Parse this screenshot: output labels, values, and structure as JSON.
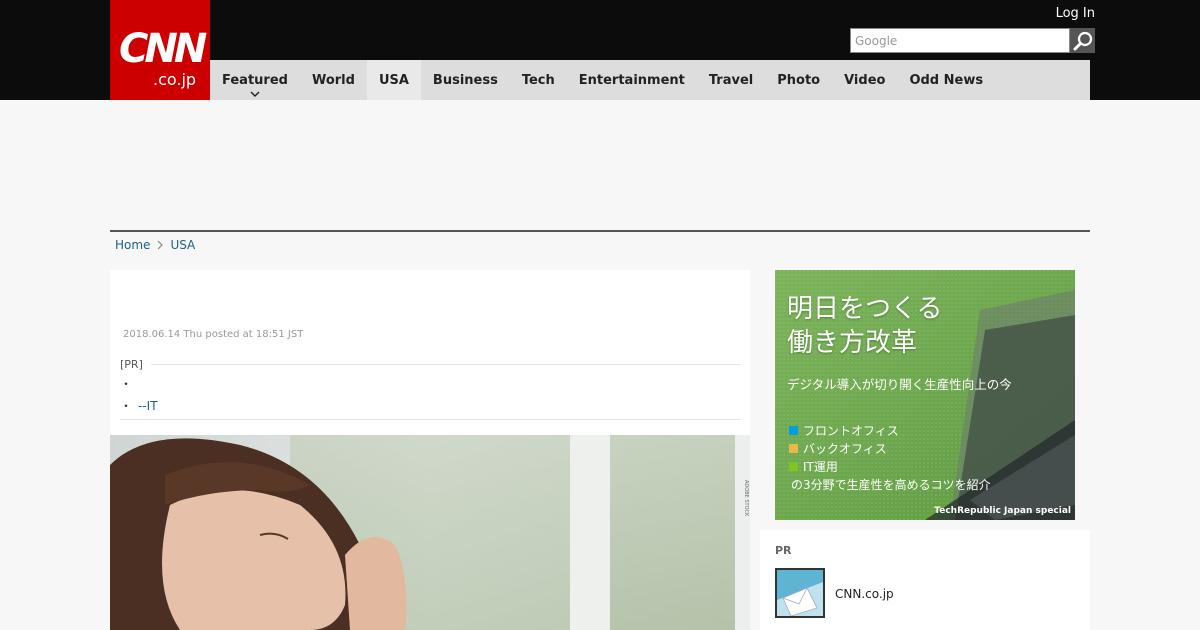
{
  "header": {
    "logo": {
      "main": "CNN",
      "sub": ".co.jp"
    },
    "login_label": "Log In",
    "search": {
      "placeholder": "Google",
      "value": "",
      "icon": "search-icon"
    }
  },
  "nav": {
    "items": [
      {
        "label": "Featured",
        "has_dropdown": true
      },
      {
        "label": "World"
      },
      {
        "label": "USA",
        "active": true
      },
      {
        "label": "Business"
      },
      {
        "label": "Tech"
      },
      {
        "label": "Entertainment"
      },
      {
        "label": "Travel"
      },
      {
        "label": "Photo"
      },
      {
        "label": "Video"
      },
      {
        "label": "Odd News"
      }
    ]
  },
  "breadcrumb": {
    "home": "Home",
    "current": "USA"
  },
  "article": {
    "dateline": "2018.06.14 Thu posted at 18:51 JST",
    "pr_label": "[PR]",
    "pr_items": [
      "",
      "--IT"
    ]
  },
  "side_banner": {
    "title_line1": "明日をつくる",
    "title_line2": "働き方改革",
    "subtitle": "デジタル導入が切り開く生産性向上の今",
    "items": [
      {
        "label": "フロントオフィス",
        "color": "#00a0e0"
      },
      {
        "label": "バックオフィス",
        "color": "#e8b84a"
      },
      {
        "label": "IT運用",
        "color": "#7ec61f"
      }
    ],
    "closing": "の3分野で生産性を高めるコツを紹介",
    "footer": "TechRepublic Japan special"
  },
  "pr_widget": {
    "label": "PR",
    "item_text": "CNN.co.jp"
  },
  "colors": {
    "brand_red": "#cc0000",
    "header_black": "#0c0c0c",
    "nav_gray": "#dddddd",
    "link_blue": "#1a5f8f",
    "banner_green": "#6fa84a"
  }
}
